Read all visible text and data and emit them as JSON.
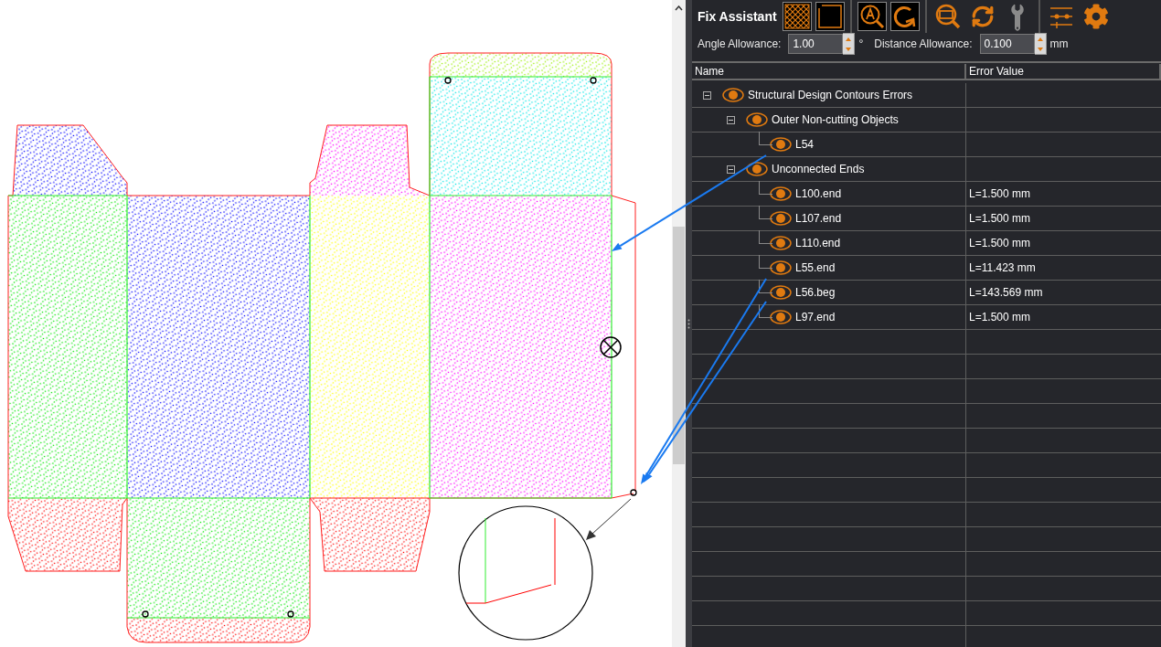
{
  "panel": {
    "title": "Fix Assistant"
  },
  "allowances": [
    {
      "label": "Angle Allowance:",
      "value": "1.00",
      "unit": "°"
    },
    {
      "label": "Distance Allowance:",
      "value": "0.100",
      "unit": "mm"
    }
  ],
  "table": {
    "columns": [
      "Name",
      "Error Value"
    ],
    "rows": [
      {
        "name": "Structural Design Contours Errors",
        "expanded": true,
        "children": [
          {
            "name": "Outer Non-cutting Objects",
            "expanded": true,
            "children": [
              {
                "name": "L54"
              }
            ]
          },
          {
            "name": "Unconnected Ends",
            "expanded": true,
            "children": [
              {
                "name": "L100.end",
                "value": "L=1.500 mm"
              },
              {
                "name": "L107.end",
                "value": "L=1.500 mm"
              },
              {
                "name": "L110.end",
                "value": "L=1.500 mm"
              },
              {
                "name": "L55.end",
                "value": "L=11.423 mm"
              },
              {
                "name": "L56.beg",
                "value": "L=143.569 mm"
              },
              {
                "name": "L97.end",
                "value": "L=1.500 mm"
              }
            ]
          }
        ]
      }
    ]
  }
}
